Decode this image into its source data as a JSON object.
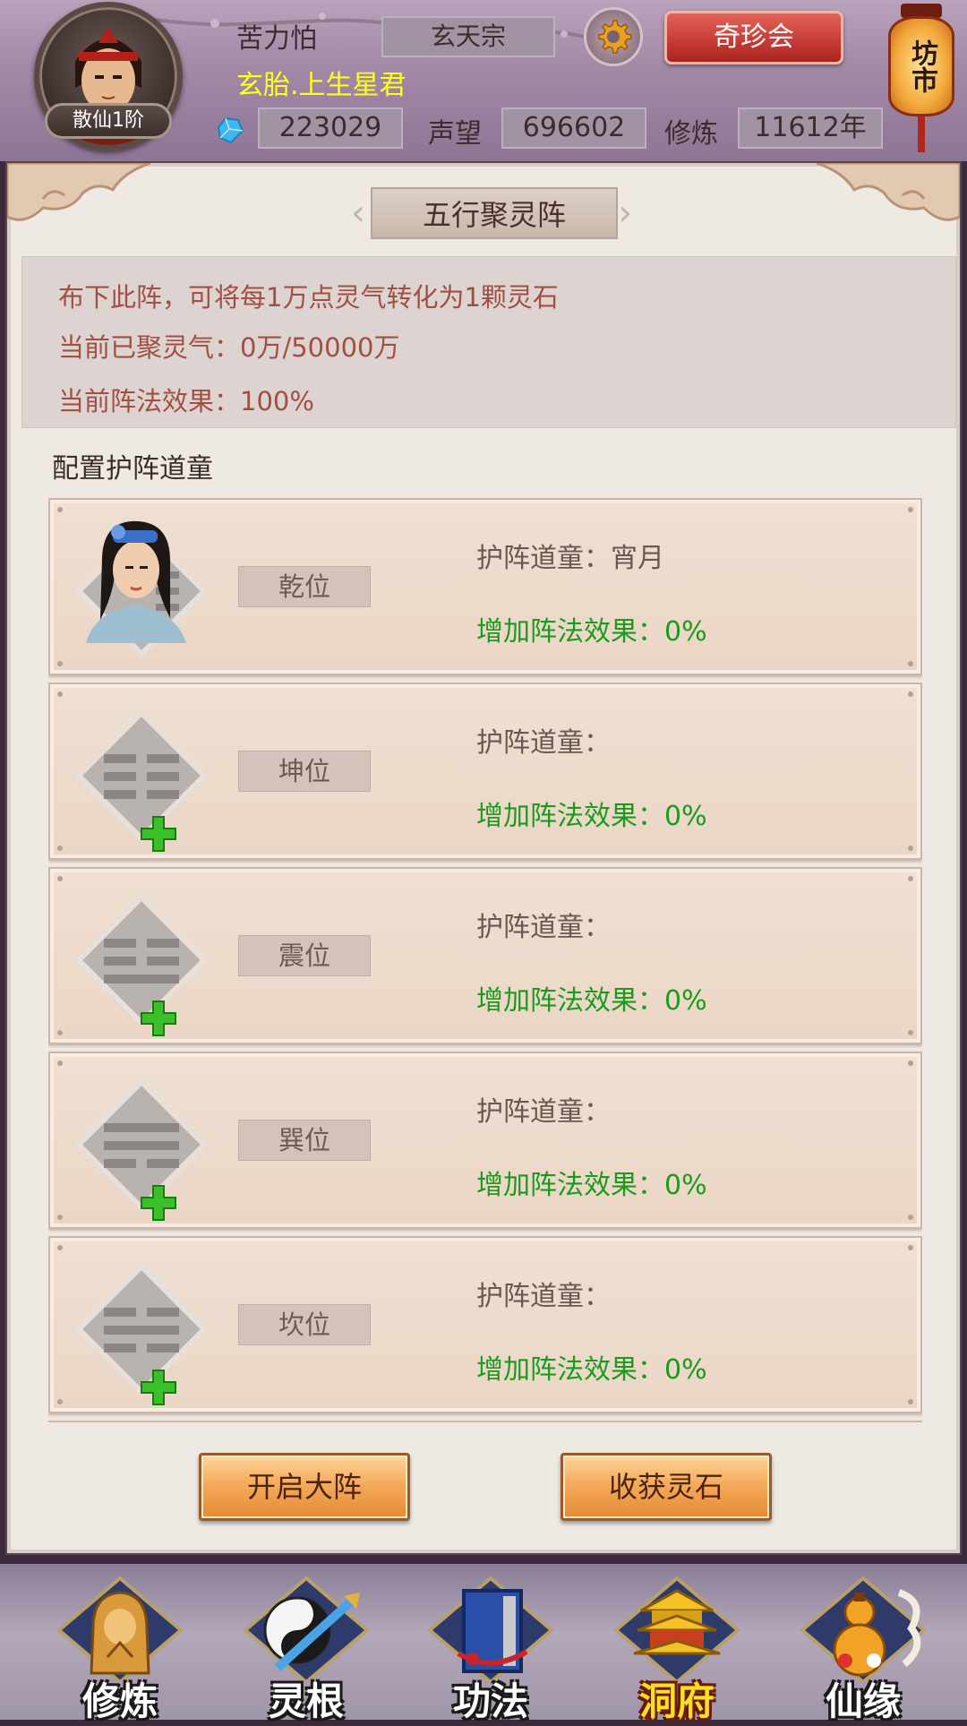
{
  "header": {
    "player_name": "苦力怕",
    "sect": "玄天宗",
    "title": "玄胎.上生星君",
    "rank": "散仙1阶",
    "treasure_button": "奇珍会",
    "market_lantern": "坊市",
    "gems": "223029",
    "reputation_label": "声望",
    "reputation": "696602",
    "cultivation_label": "修炼",
    "cultivation": "11612年"
  },
  "panel": {
    "title": "五行聚灵阵",
    "info": {
      "line1": "布下此阵，可将每1万点灵气转化为1颗灵石",
      "line2": "当前已聚灵气：0万/50000万",
      "line3": "当前阵法效果：100%"
    },
    "section_label": "配置护阵道童",
    "slots": [
      {
        "position": "乾位",
        "guard": "护阵道童：宵月",
        "effect": "增加阵法效果：0%",
        "assigned": true
      },
      {
        "position": "坤位",
        "guard": "护阵道童：",
        "effect": "增加阵法效果：0%",
        "assigned": false
      },
      {
        "position": "震位",
        "guard": "护阵道童：",
        "effect": "增加阵法效果：0%",
        "assigned": false
      },
      {
        "position": "巽位",
        "guard": "护阵道童：",
        "effect": "增加阵法效果：0%",
        "assigned": false
      },
      {
        "position": "坎位",
        "guard": "护阵道童：",
        "effect": "增加阵法效果：0%",
        "assigned": false
      }
    ],
    "buttons": {
      "open": "开启大阵",
      "harvest": "收获灵石"
    }
  },
  "nav": {
    "items": [
      {
        "label": "修炼",
        "icon": "meditating-monk-icon",
        "active": false
      },
      {
        "label": "灵根",
        "icon": "yin-yang-sword-icon",
        "active": false
      },
      {
        "label": "功法",
        "icon": "scroll-book-icon",
        "active": false
      },
      {
        "label": "洞府",
        "icon": "pagoda-icon",
        "active": true
      },
      {
        "label": "仙缘",
        "icon": "gourd-icon",
        "active": false
      }
    ]
  },
  "colors": {
    "accent_red": "#c73934",
    "title_yellow": "#ffff1a",
    "effect_green": "#1d9a1d",
    "info_text": "#a14f43",
    "button_orange": "#f4ab5c"
  }
}
